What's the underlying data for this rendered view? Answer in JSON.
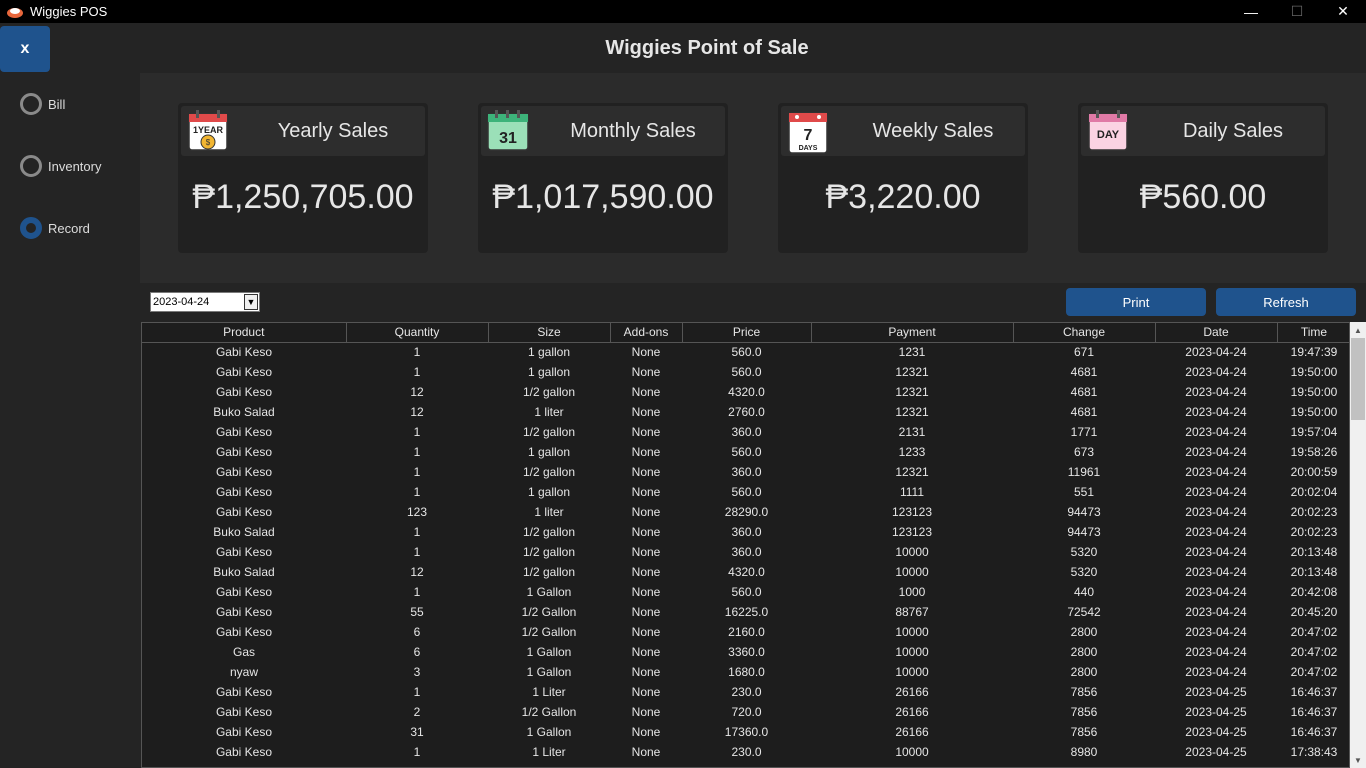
{
  "window": {
    "title": "Wiggies POS",
    "minimize": "—",
    "maximize": "☐",
    "close": "✕"
  },
  "sidebar": {
    "close_label": "x",
    "items": [
      {
        "label": "Bill",
        "checked": false
      },
      {
        "label": "Inventory",
        "checked": false
      },
      {
        "label": "Record",
        "checked": true
      }
    ]
  },
  "header": {
    "title": "Wiggies Point of Sale"
  },
  "cards": [
    {
      "label": "Yearly Sales",
      "value": "₱1,250,705.00",
      "icon": "1-year-calendar-icon"
    },
    {
      "label": "Monthly Sales",
      "value": "₱1,017,590.00",
      "icon": "31-calendar-icon"
    },
    {
      "label": "Weekly Sales",
      "value": "₱3,220.00",
      "icon": "7-days-calendar-icon"
    },
    {
      "label": "Daily Sales",
      "value": "₱560.00",
      "icon": "day-calendar-icon"
    }
  ],
  "toolbar": {
    "date_value": "2023-04-24",
    "print_label": "Print",
    "refresh_label": "Refresh"
  },
  "table": {
    "columns": [
      "Product",
      "Quantity",
      "Size",
      "Add-ons",
      "Price",
      "Payment",
      "Change",
      "Date",
      "Time"
    ],
    "rows": [
      [
        "Gabi Keso",
        "1",
        "1 gallon",
        "None",
        "560.0",
        "1231",
        "671",
        "2023-04-24",
        "19:47:39"
      ],
      [
        "Gabi Keso",
        "1",
        "1 gallon",
        "None",
        "560.0",
        "12321",
        "4681",
        "2023-04-24",
        "19:50:00"
      ],
      [
        "Gabi Keso",
        "12",
        "1/2 gallon",
        "None",
        "4320.0",
        "12321",
        "4681",
        "2023-04-24",
        "19:50:00"
      ],
      [
        "Buko Salad",
        "12",
        "1 liter",
        "None",
        "2760.0",
        "12321",
        "4681",
        "2023-04-24",
        "19:50:00"
      ],
      [
        "Gabi Keso",
        "1",
        "1/2 gallon",
        "None",
        "360.0",
        "2131",
        "1771",
        "2023-04-24",
        "19:57:04"
      ],
      [
        "Gabi Keso",
        "1",
        "1 gallon",
        "None",
        "560.0",
        "1233",
        "673",
        "2023-04-24",
        "19:58:26"
      ],
      [
        "Gabi Keso",
        "1",
        "1/2 gallon",
        "None",
        "360.0",
        "12321",
        "11961",
        "2023-04-24",
        "20:00:59"
      ],
      [
        "Gabi Keso",
        "1",
        "1 gallon",
        "None",
        "560.0",
        "1111",
        "551",
        "2023-04-24",
        "20:02:04"
      ],
      [
        "Gabi Keso",
        "123",
        "1 liter",
        "None",
        "28290.0",
        "123123",
        "94473",
        "2023-04-24",
        "20:02:23"
      ],
      [
        "Buko Salad",
        "1",
        "1/2 gallon",
        "None",
        "360.0",
        "123123",
        "94473",
        "2023-04-24",
        "20:02:23"
      ],
      [
        "Gabi Keso",
        "1",
        "1/2 gallon",
        "None",
        "360.0",
        "10000",
        "5320",
        "2023-04-24",
        "20:13:48"
      ],
      [
        "Buko Salad",
        "12",
        "1/2 gallon",
        "None",
        "4320.0",
        "10000",
        "5320",
        "2023-04-24",
        "20:13:48"
      ],
      [
        "Gabi Keso",
        "1",
        "1 Gallon",
        "None",
        "560.0",
        "1000",
        "440",
        "2023-04-24",
        "20:42:08"
      ],
      [
        "Gabi Keso",
        "55",
        "1/2 Gallon",
        "None",
        "16225.0",
        "88767",
        "72542",
        "2023-04-24",
        "20:45:20"
      ],
      [
        "Gabi Keso",
        "6",
        "1/2 Gallon",
        "None",
        "2160.0",
        "10000",
        "2800",
        "2023-04-24",
        "20:47:02"
      ],
      [
        "Gas",
        "6",
        "1 Gallon",
        "None",
        "3360.0",
        "10000",
        "2800",
        "2023-04-24",
        "20:47:02"
      ],
      [
        "nyaw",
        "3",
        "1 Gallon",
        "None",
        "1680.0",
        "10000",
        "2800",
        "2023-04-24",
        "20:47:02"
      ],
      [
        "Gabi Keso",
        "1",
        "1 Liter",
        "None",
        "230.0",
        "26166",
        "7856",
        "2023-04-25",
        "16:46:37"
      ],
      [
        "Gabi Keso",
        "2",
        "1/2 Gallon",
        "None",
        "720.0",
        "26166",
        "7856",
        "2023-04-25",
        "16:46:37"
      ],
      [
        "Gabi Keso",
        "31",
        "1 Gallon",
        "None",
        "17360.0",
        "26166",
        "7856",
        "2023-04-25",
        "16:46:37"
      ],
      [
        "Gabi Keso",
        "1",
        "1 Liter",
        "None",
        "230.0",
        "10000",
        "8980",
        "2023-04-25",
        "17:38:43"
      ]
    ]
  },
  "colors": {
    "accent": "#1f538d",
    "background": "#242424",
    "panel": "#2b2b2b"
  }
}
